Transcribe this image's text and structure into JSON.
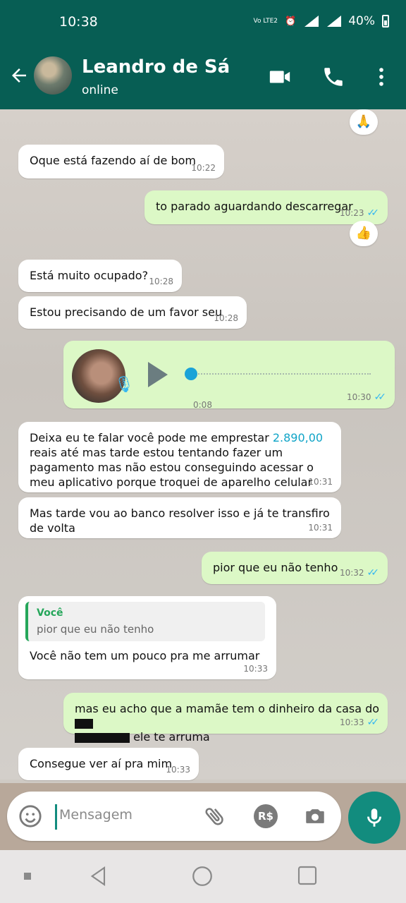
{
  "status_bar": {
    "time": "10:38",
    "lte": "Vo LTE2",
    "sig1": "4G",
    "sig2": "4G",
    "battery": "40%"
  },
  "header": {
    "name": "Leandro de Sá",
    "status": "online"
  },
  "messages": [
    {
      "id": "m1",
      "dir": "in",
      "text": "Oque está fazendo aí de bom",
      "time": "10:22"
    },
    {
      "id": "m2",
      "dir": "out",
      "text": "to parado aguardando descarregar",
      "time": "10:23"
    },
    {
      "id": "m3",
      "dir": "in",
      "text": "Está muito ocupado?",
      "time": "10:28"
    },
    {
      "id": "m4",
      "dir": "in",
      "text": "Estou precisando de um favor seu",
      "time": "10:28"
    },
    {
      "id": "m5",
      "dir": "out",
      "type": "voice",
      "duration": "0:08",
      "time": "10:30",
      "progress": 0
    },
    {
      "id": "m6",
      "dir": "in",
      "text_a": "Deixa eu te falar você pode me emprestar ",
      "amount": "2.890,00",
      "text_b": " reais até mas tarde estou tentando fazer um pagamento mas não estou conseguindo acessar o meu aplicativo porque troquei de aparelho celular",
      "time": "10:31"
    },
    {
      "id": "m7",
      "dir": "in",
      "text": "Mas tarde vou ao banco resolver isso e já te transfiro de volta",
      "time": "10:31"
    },
    {
      "id": "m8",
      "dir": "out",
      "text": "pior que eu não tenho",
      "time": "10:32"
    },
    {
      "id": "m9",
      "dir": "in",
      "quote_name": "Você",
      "quote_text": "pior que eu não tenho",
      "text": "Você não tem um pouco pra me arrumar",
      "time": "10:33"
    },
    {
      "id": "m10",
      "dir": "out",
      "text_a": "mas eu acho que a mamãe tem o dinheiro da casa do ",
      "text_b": " ele te arruma",
      "time": "10:33"
    },
    {
      "id": "m11",
      "dir": "in",
      "text": "Consegue ver aí pra mim",
      "time": "10:33"
    }
  ],
  "reactions": {
    "r1": "🙏",
    "r2": "👍"
  },
  "input": {
    "placeholder": "Mensagem",
    "currency_label": "R$"
  }
}
